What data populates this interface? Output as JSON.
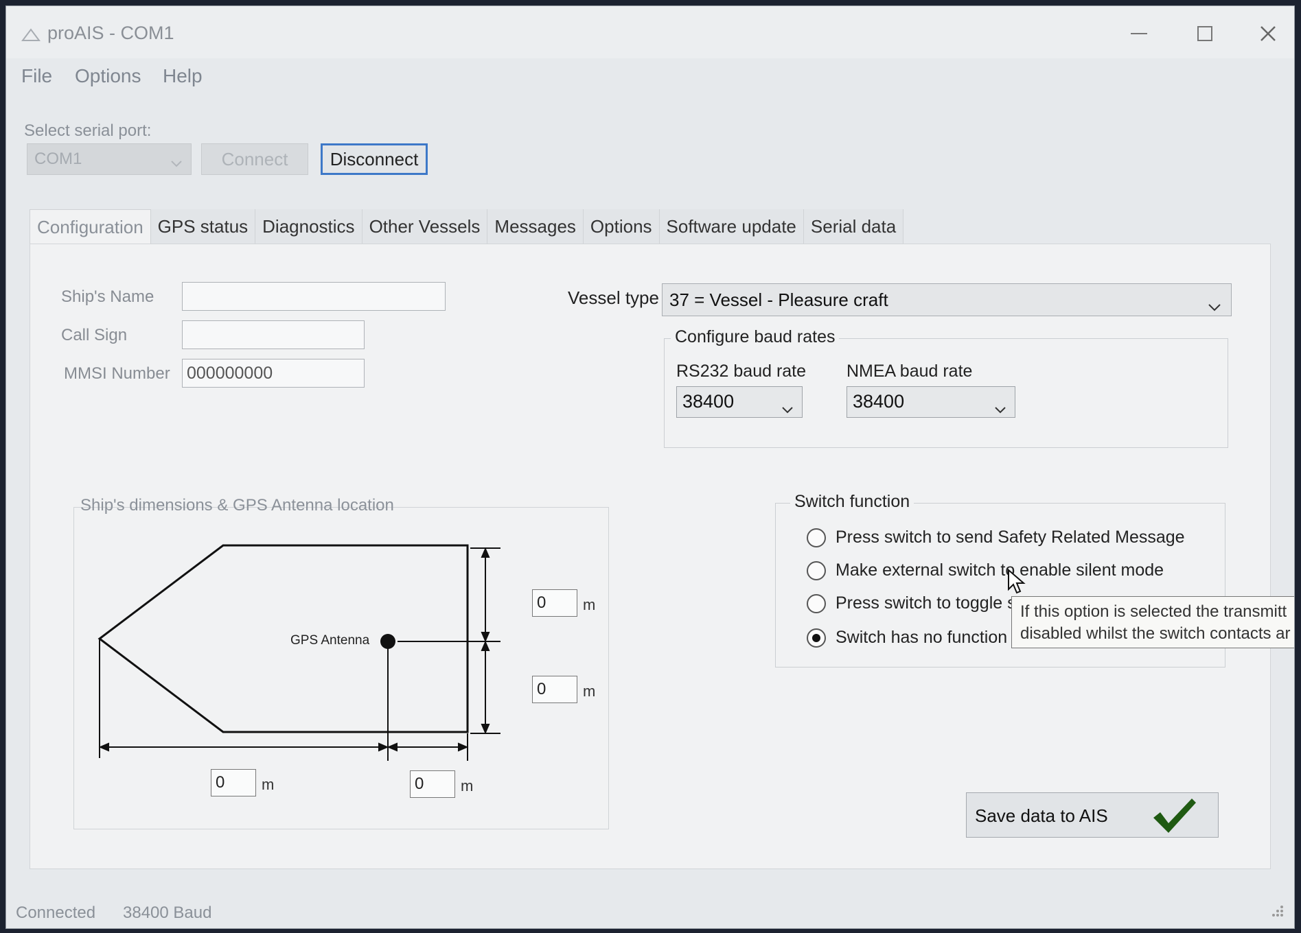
{
  "window": {
    "title": "proAIS - COM1"
  },
  "menu": {
    "items": [
      "File",
      "Options",
      "Help"
    ]
  },
  "serial": {
    "label": "Select serial port:",
    "port_value": "COM1",
    "connect_label": "Connect",
    "disconnect_label": "Disconnect"
  },
  "tabs": [
    "Configuration",
    "GPS status",
    "Diagnostics",
    "Other Vessels",
    "Messages",
    "Options",
    "Software update",
    "Serial data"
  ],
  "config": {
    "ship_name_label": "Ship's Name",
    "ship_name_value": "",
    "call_sign_label": "Call Sign",
    "call_sign_value": "",
    "mmsi_label": "MMSI Number",
    "mmsi_value": "000000000",
    "vessel_type_label": "Vessel type",
    "vessel_type_value": "37 =  Vessel - Pleasure craft",
    "baud_group_title": "Configure baud rates",
    "rs232_label": "RS232 baud rate",
    "rs232_value": "38400",
    "nmea_label": "NMEA baud rate",
    "nmea_value": "38400"
  },
  "dimensions": {
    "title": "Ship's dimensions & GPS Antenna location",
    "gps_antenna_label": "GPS Antenna",
    "unit": "m",
    "dim_a": "0",
    "dim_b": "0",
    "dim_c": "0",
    "dim_d": "0"
  },
  "switch_function": {
    "title": "Switch function",
    "options": [
      "Press switch to send Safety Related Message",
      "Make external switch to enable silent mode",
      "Press switch to toggle sile",
      "Switch has no function"
    ],
    "selected_index": 3,
    "tooltip_line1": "If this option is selected the transmitt",
    "tooltip_line2": "disabled whilst the switch contacts ar"
  },
  "save_button_label": "Save data to AIS",
  "status": {
    "connection": "Connected",
    "baud": "38400 Baud"
  },
  "colors": {
    "accent_border": "#3d78c8",
    "checkmark": "#1f5a12"
  }
}
